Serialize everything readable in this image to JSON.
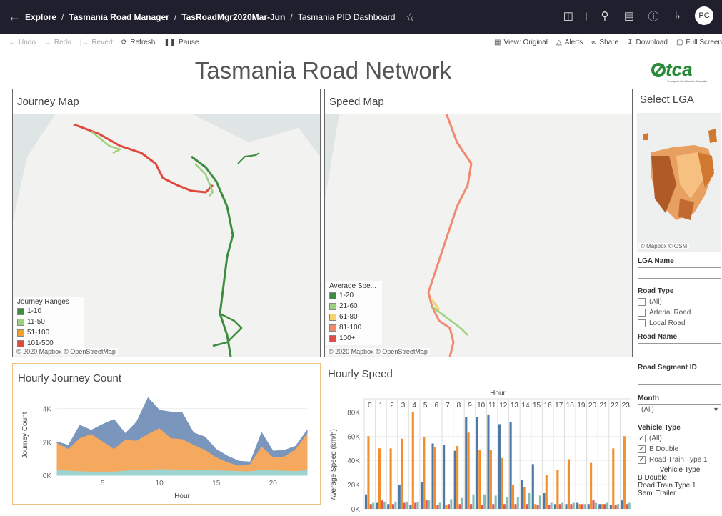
{
  "breadcrumb": {
    "explore": "Explore",
    "project": "Tasmania Road Manager",
    "workbook": "TasRoadMgr2020Mar-Jun",
    "view": "Tasmania PID Dashboard"
  },
  "user_initials": "PC",
  "toolbar": {
    "undo": "Undo",
    "redo": "Redo",
    "revert": "Revert",
    "refresh": "Refresh",
    "pause": "Pause",
    "view": "View: Original",
    "alerts": "Alerts",
    "share": "Share",
    "download": "Download",
    "fullscreen": "Full Screen"
  },
  "dashboard_title": "Tasmania Road Network",
  "logo_text": "tca",
  "logo_subtext": "Transport Certification Australia",
  "journey_map": {
    "title": "Journey Map",
    "legend_title": "Journey Ranges",
    "legend": [
      {
        "label": "1-10",
        "color": "#3d8c40"
      },
      {
        "label": "11-50",
        "color": "#9ed17f"
      },
      {
        "label": "51-100",
        "color": "#f0a030"
      },
      {
        "label": "101-500",
        "color": "#e0493f"
      }
    ],
    "copyright": "© 2020 Mapbox © OpenStreetMap"
  },
  "speed_map": {
    "title": "Speed Map",
    "legend_title": "Average Spe...",
    "legend": [
      {
        "label": "1-20",
        "color": "#3d8c40"
      },
      {
        "label": "21-60",
        "color": "#9ed17f"
      },
      {
        "label": "61-80",
        "color": "#f5d46a"
      },
      {
        "label": "81-100",
        "color": "#f08a70"
      },
      {
        "label": "100+",
        "color": "#e04a48"
      }
    ],
    "copyright": "© 2020 Mapbox © OpenStreetMap"
  },
  "lga_panel": {
    "title": "Select LGA",
    "copyright": "© Mapbox © OSM",
    "lga_name_label": "LGA Name",
    "road_type_label": "Road Type",
    "road_type_options": [
      {
        "label": "(All)",
        "checked": false
      },
      {
        "label": "Arterial Road",
        "checked": false
      },
      {
        "label": "Local Road",
        "checked": false
      }
    ],
    "road_name_label": "Road Name",
    "road_segment_label": "Road Segment ID",
    "month_label": "Month",
    "month_value": "(All)",
    "vehicle_type_label": "Vehicle Type",
    "vehicle_type_options": [
      {
        "label": "(All)",
        "checked": true
      },
      {
        "label": "B Double",
        "checked": true
      },
      {
        "label": "Road Train Type 1",
        "checked": true
      }
    ],
    "legend_title": "Vehicle Type",
    "legend": [
      {
        "label": "B Double",
        "color": "#4e79a7"
      },
      {
        "label": "Road Train Type 1",
        "color": "#f28e2b"
      },
      {
        "label": "Semi Trailer",
        "color": "#e15759"
      }
    ]
  },
  "chart_data": [
    {
      "type": "area",
      "title": "Hourly Journey Count",
      "xlabel": "Hour",
      "ylabel": "Journey Count",
      "xlim": [
        1,
        23
      ],
      "ylim": [
        0,
        4800
      ],
      "x_ticks": [
        5,
        10,
        15,
        20
      ],
      "y_ticks": [
        "0K",
        "2K",
        "4K"
      ],
      "x": [
        1,
        2,
        3,
        4,
        5,
        6,
        7,
        8,
        9,
        10,
        11,
        12,
        13,
        14,
        15,
        16,
        17,
        18,
        19,
        20,
        21,
        22,
        23
      ],
      "series": [
        {
          "name": "B Double",
          "color": "#7b96bd",
          "values": [
            2000,
            1800,
            3000,
            2700,
            3050,
            3350,
            2500,
            3200,
            4650,
            3900,
            3800,
            3750,
            2550,
            2300,
            1550,
            1150,
            850,
            800,
            2550,
            1450,
            1500,
            1750,
            2700
          ]
        },
        {
          "name": "Road Train Type 1",
          "color": "#f5a95e",
          "values": [
            1900,
            1550,
            2200,
            2450,
            2000,
            1550,
            2100,
            2050,
            2450,
            2800,
            2200,
            2150,
            1800,
            1500,
            1050,
            750,
            550,
            650,
            1700,
            1050,
            1100,
            1550,
            2450
          ]
        },
        {
          "name": "Semi Trailer",
          "color": "#9fd3d0",
          "values": [
            300,
            250,
            220,
            200,
            200,
            200,
            250,
            300,
            280,
            350,
            330,
            320,
            300,
            280,
            280,
            250,
            230,
            220,
            300,
            280,
            250,
            230,
            280
          ]
        }
      ]
    },
    {
      "type": "bar",
      "title": "Hourly Speed",
      "xlabel": "Hour",
      "ylabel": "Average Speed (km/h)",
      "ylim": [
        0,
        85000
      ],
      "y_ticks": [
        "0K",
        "20K",
        "40K",
        "60K",
        "80K"
      ],
      "categories": [
        "0",
        "1",
        "2",
        "3",
        "4",
        "5",
        "6",
        "7",
        "8",
        "9",
        "10",
        "11",
        "12",
        "13",
        "14",
        "15",
        "16",
        "17",
        "18",
        "19",
        "20",
        "21",
        "22",
        "23"
      ],
      "series": [
        {
          "name": "B Double",
          "color": "#4e79a7",
          "values": [
            12000,
            5000,
            4000,
            20000,
            3000,
            22000,
            54000,
            53000,
            48000,
            76000,
            76000,
            78000,
            70000,
            72000,
            24000,
            37000,
            13000,
            4000,
            4000,
            5000,
            4000,
            4000,
            3000,
            7000
          ]
        },
        {
          "name": "Road Train Type 1",
          "color": "#f28e2b",
          "values": [
            60000,
            50000,
            50000,
            58000,
            80000,
            59000,
            51000,
            3000,
            52000,
            63000,
            49000,
            49000,
            42000,
            20000,
            18000,
            4000,
            28000,
            32000,
            41000,
            4000,
            38000,
            4000,
            50000,
            60000
          ]
        },
        {
          "name": "Semi Trailer",
          "color": "#e15759",
          "values": [
            4000,
            7000,
            4000,
            5000,
            5000,
            7000,
            3000,
            4000,
            4000,
            4000,
            3000,
            4000,
            4000,
            4000,
            4000,
            3000,
            3000,
            4000,
            4000,
            4000,
            7000,
            4000,
            3000,
            4000
          ]
        },
        {
          "name": "",
          "color": "#86bcb6",
          "values": [
            5000,
            6000,
            6000,
            6000,
            6000,
            7000,
            5000,
            8000,
            9000,
            12000,
            12000,
            11000,
            10000,
            10000,
            13000,
            11000,
            5000,
            5000,
            5000,
            4000,
            5000,
            5000,
            4000,
            5000
          ]
        }
      ]
    }
  ]
}
